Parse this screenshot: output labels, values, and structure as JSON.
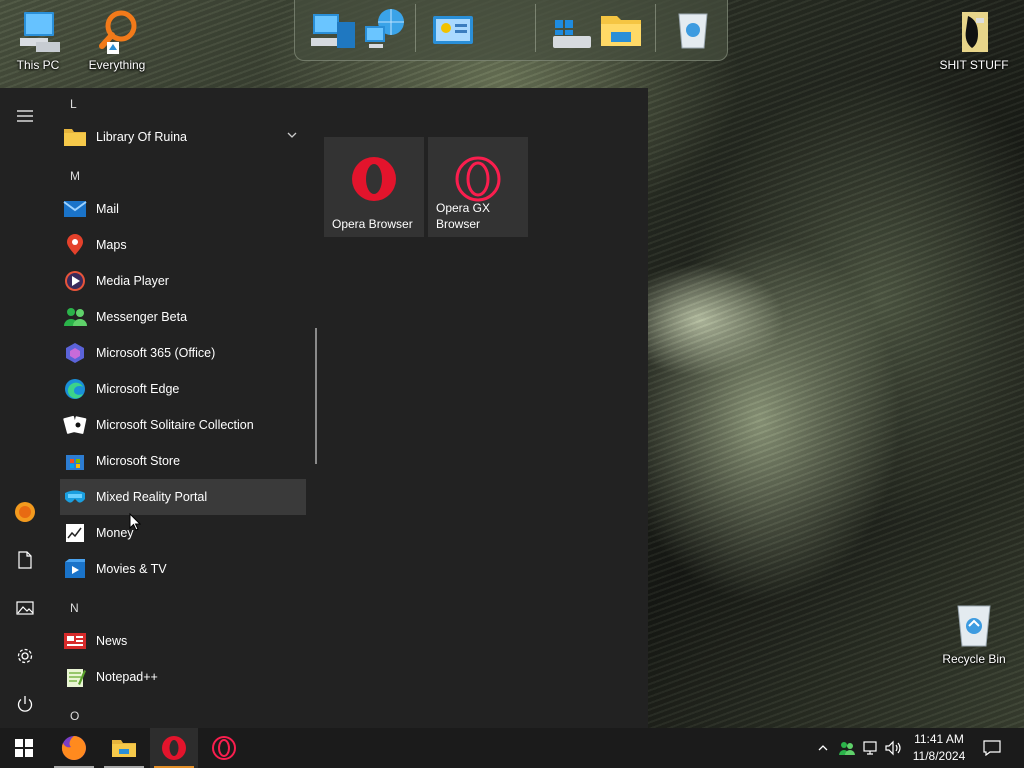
{
  "desktop": {
    "icons": [
      {
        "label": "This PC"
      },
      {
        "label": "Everything"
      },
      {
        "label": "SHIT STUFF"
      },
      {
        "label": "Recycle Bin"
      }
    ]
  },
  "top_bar": {
    "icons": [
      "computer-icon",
      "network-globe-icon",
      "control-panel-icon",
      "drive-windows-icon",
      "file-explorer-folder-icon",
      "recycle-bin-icon"
    ]
  },
  "start_menu": {
    "rail": [
      "hamburger-menu-icon",
      "user-avatar-icon",
      "documents-icon",
      "pictures-icon",
      "settings-icon",
      "power-icon"
    ],
    "letters": {
      "l": "L",
      "m": "M",
      "n": "N",
      "o": "O"
    },
    "apps": [
      {
        "name": "Library Of Ruina",
        "icon": "folder-icon",
        "has_chevron": true
      },
      {
        "name": "Mail",
        "icon": "mail-icon"
      },
      {
        "name": "Maps",
        "icon": "maps-pin-icon"
      },
      {
        "name": "Media Player",
        "icon": "media-player-icon"
      },
      {
        "name": "Messenger Beta",
        "icon": "messenger-icon"
      },
      {
        "name": "Microsoft 365 (Office)",
        "icon": "office-icon"
      },
      {
        "name": "Microsoft Edge",
        "icon": "edge-icon"
      },
      {
        "name": "Microsoft Solitaire Collection",
        "icon": "cards-icon"
      },
      {
        "name": "Microsoft Store",
        "icon": "store-icon"
      },
      {
        "name": "Mixed Reality Portal",
        "icon": "mixed-reality-icon",
        "hovered": true
      },
      {
        "name": "Money",
        "icon": "money-chart-icon"
      },
      {
        "name": "Movies & TV",
        "icon": "movies-tv-icon"
      },
      {
        "name": "News",
        "icon": "news-icon"
      },
      {
        "name": "Notepad++",
        "icon": "notepadpp-icon"
      }
    ],
    "tiles": [
      {
        "label": "Opera Browser",
        "icon": "opera-icon"
      },
      {
        "label": "Opera GX Browser",
        "icon": "opera-gx-icon"
      }
    ]
  },
  "taskbar": {
    "apps": [
      {
        "name": "start-button",
        "icon": "windows-logo-icon"
      },
      {
        "name": "firefox",
        "icon": "firefox-icon"
      },
      {
        "name": "file-explorer",
        "icon": "folder-icon"
      },
      {
        "name": "opera",
        "icon": "opera-icon",
        "active": true
      },
      {
        "name": "opera-gx",
        "icon": "opera-gx-icon"
      }
    ],
    "tray": {
      "time": "11:41 AM",
      "date": "11/8/2024"
    }
  },
  "colors": {
    "menu_bg": "#222222",
    "hover_bg": "#3a3a3a",
    "tile_bg": "#333333",
    "taskbar_bg": "#1b1b1b",
    "opera_red": "#e3142c",
    "opera_gx_red": "#fa1e4e"
  }
}
